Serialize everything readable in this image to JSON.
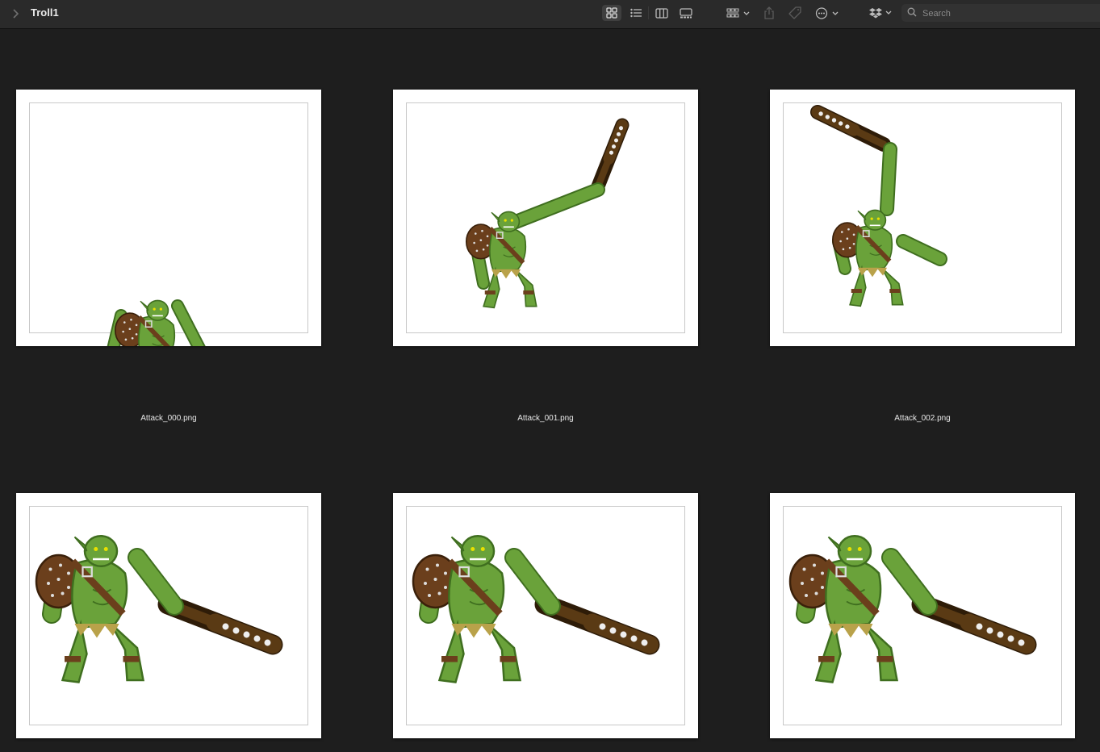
{
  "window": {
    "title": "Troll1"
  },
  "toolbar": {
    "back_icon": "chevron-right-icon",
    "view_icons": [
      "grid-view-icon",
      "list-view-icon",
      "column-view-icon",
      "gallery-view-icon"
    ],
    "group_icon": "group-by-icon",
    "share_icon": "share-icon",
    "tag_icon": "tag-icon",
    "more_icon": "ellipsis-circle-icon",
    "dropbox_icon": "dropbox-icon"
  },
  "search": {
    "placeholder": "Search",
    "value": ""
  },
  "files": [
    {
      "name": "Attack_000.png",
      "pose": "crouch-club-down"
    },
    {
      "name": "Attack_001.png",
      "pose": "club-raised"
    },
    {
      "name": "Attack_002.png",
      "pose": "club-overhead"
    },
    {
      "name": "",
      "pose": "club-forward"
    },
    {
      "name": "",
      "pose": "club-forward"
    },
    {
      "name": "",
      "pose": "club-forward"
    }
  ],
  "colors": {
    "background": "#1e1e1e",
    "toolbar": "#2a2a2a",
    "troll_skin": "#6aa23a",
    "troll_shadow": "#3f6e1f",
    "leather": "#6b3f1c",
    "club": "#5a3a14"
  }
}
